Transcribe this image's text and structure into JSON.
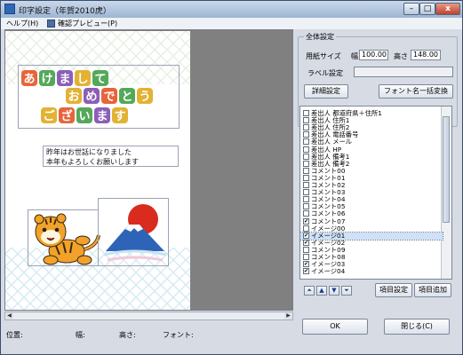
{
  "window": {
    "title": "印字設定（年賀2010虎）",
    "minimize_glyph": "–",
    "maximize_glyph": "□",
    "close_glyph": "x"
  },
  "menu": {
    "help": "ヘルプ(H)",
    "preview": "確認プレビュー(P)"
  },
  "preview": {
    "message_line1": "昨年はお世話になりました",
    "message_line2": "本年もよろしくお願いします",
    "greeting_images": "あけましておめでとうございます"
  },
  "status": {
    "position_label": "位置:",
    "width_label": "幅:",
    "height_label": "高さ:",
    "font_label": "フォント:"
  },
  "settings": {
    "group_title": "全体設定",
    "paper_size_label": "用紙サイズ",
    "width_label": "幅",
    "width_value": "100.00",
    "height_label": "高さ",
    "height_value": "148.00",
    "label_setting_label": "ラベル設定",
    "label_setting_value": "",
    "detail_button": "詳細設定",
    "font_batch_button": "フォント名一括変換"
  },
  "items": [
    {
      "label": "差出人 都道府県＋住所1",
      "checked": false
    },
    {
      "label": "差出人 住所1",
      "checked": false
    },
    {
      "label": "差出人 住所2",
      "checked": false
    },
    {
      "label": "差出人 電話番号",
      "checked": false
    },
    {
      "label": "差出人 メール",
      "checked": false
    },
    {
      "label": "差出人 HP",
      "checked": false
    },
    {
      "label": "差出人 備考1",
      "checked": false
    },
    {
      "label": "差出人 備考2",
      "checked": false
    },
    {
      "label": "コメント00",
      "checked": false
    },
    {
      "label": "コメント01",
      "checked": false
    },
    {
      "label": "コメント02",
      "checked": false
    },
    {
      "label": "コメント03",
      "checked": false
    },
    {
      "label": "コメント04",
      "checked": false
    },
    {
      "label": "コメント05",
      "checked": false
    },
    {
      "label": "コメント06",
      "checked": false
    },
    {
      "label": "コメント07",
      "checked": true
    },
    {
      "label": "イメージ00",
      "checked": false
    },
    {
      "label": "イメージ01",
      "checked": true,
      "highlighted": true
    },
    {
      "label": "イメージ02",
      "checked": true
    },
    {
      "label": "コメント09",
      "checked": false
    },
    {
      "label": "コメント08",
      "checked": false
    },
    {
      "label": "イメージ03",
      "checked": true
    },
    {
      "label": "イメージ04",
      "checked": true
    }
  ],
  "order_buttons": {
    "top": "⏶",
    "up": "▲",
    "down": "▼",
    "bottom": "⏷"
  },
  "item_settings_button": "項目設定",
  "add_item_button": "項目追加",
  "ok_button": "OK",
  "close_button": "閉じる(C)",
  "icons": {
    "app": "app-icon",
    "preview": "preview-icon"
  },
  "colors": {
    "title_gradient_top": "#c9d8ea",
    "title_gradient_bottom": "#9db5d3",
    "canvas_gray": "#808080",
    "card_white": "#ffffff",
    "close_red": "#c0412c",
    "tile_orange": "#e7653a",
    "tile_green": "#55a85a",
    "tile_purple": "#8b5fb8",
    "tile_yellow": "#e3b234",
    "sun_red": "#d92b1e",
    "fuji_blue": "#2e64b7"
  }
}
